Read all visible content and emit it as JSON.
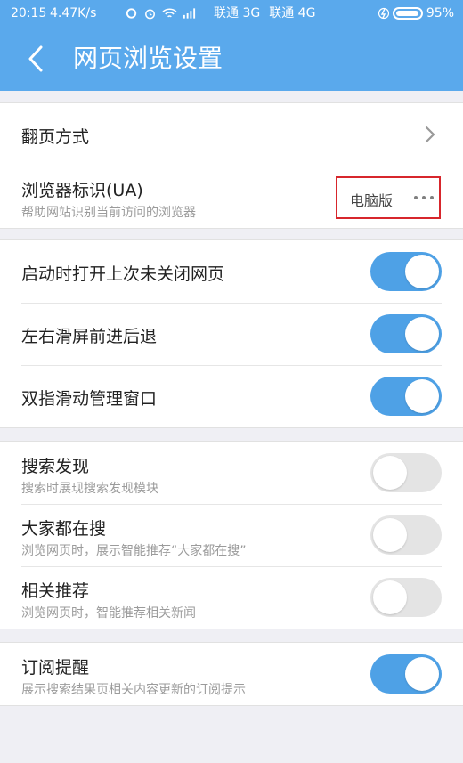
{
  "status_bar": {
    "time": "20:15",
    "speed": "4.47K/s",
    "carrier1": "联通 3G",
    "carrier2": "联通 4G",
    "battery_percent": "95%",
    "battery_level": 0.95
  },
  "header": {
    "title": "网页浏览设置",
    "accent_color": "#5aa9ec"
  },
  "sections": {
    "page_mode": {
      "label": "翻页方式"
    },
    "ua": {
      "label": "浏览器标识(UA)",
      "sub": "帮助网站识别当前访问的浏览器",
      "value": "电脑版"
    },
    "restore_tabs": {
      "label": "启动时打开上次未关闭网页",
      "on": true
    },
    "swipe_nav": {
      "label": "左右滑屏前进后退",
      "on": true
    },
    "two_finger": {
      "label": "双指滑动管理窗口",
      "on": true
    },
    "search_discover": {
      "label": "搜索发现",
      "sub": "搜索时展现搜索发现模块",
      "on": false
    },
    "everyone_search": {
      "label": "大家都在搜",
      "sub": "浏览网页时，展示智能推荐“大家都在搜”",
      "on": false
    },
    "related": {
      "label": "相关推荐",
      "sub": "浏览网页时，智能推荐相关新闻",
      "on": false
    },
    "subscription": {
      "label": "订阅提醒",
      "sub": "展示搜索结果页相关内容更新的订阅提示",
      "on": true
    }
  },
  "colors": {
    "toggle_on": "#4ea1e6",
    "toggle_off": "#e4e4e4",
    "highlight_box": "#d7262c"
  }
}
